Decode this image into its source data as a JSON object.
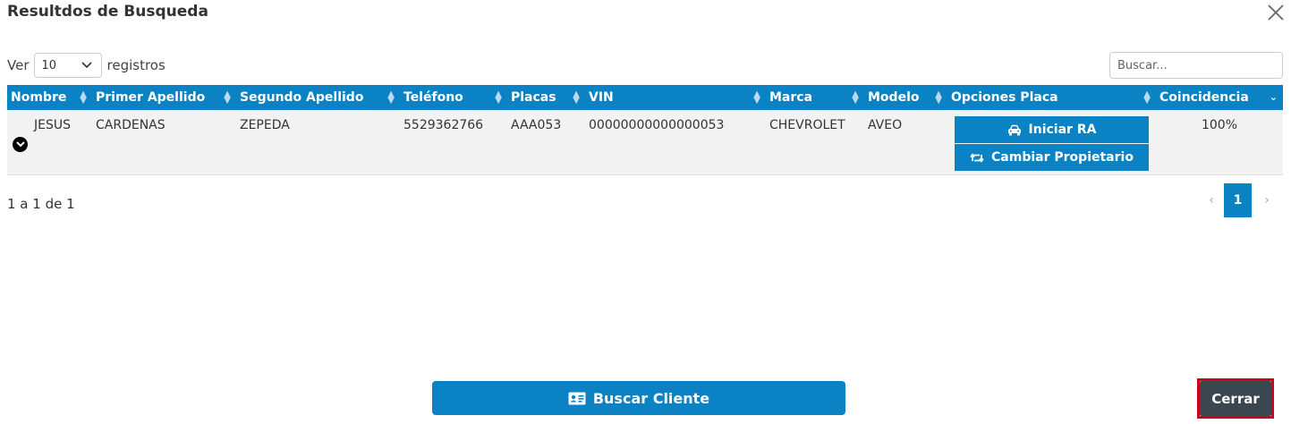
{
  "modal": {
    "title": "Resultdos de Busqueda"
  },
  "length_menu": {
    "prefix": "Ver",
    "value": "10",
    "suffix": "registros"
  },
  "search": {
    "placeholder": "Buscar..."
  },
  "table": {
    "columns": [
      "Nombre",
      "Primer Apellido",
      "Segundo Apellido",
      "Teléfono",
      "Placas",
      "VIN",
      "Marca",
      "Modelo",
      "Opciones Placa",
      "Coincidencia"
    ],
    "rows": [
      {
        "nombre": "JESUS",
        "primer_apellido": "CARDENAS",
        "segundo_apellido": "ZEPEDA",
        "telefono": "5529362766",
        "placas": "AAA053",
        "vin": "00000000000000053",
        "marca": "CHEVROLET",
        "modelo": "AVEO",
        "opciones": {
          "iniciar_label": "Iniciar RA",
          "cambiar_label": "Cambiar Propietario"
        },
        "coincidencia": "100%"
      }
    ]
  },
  "info": "1 a 1 de 1",
  "pagination": {
    "prev": "‹",
    "current": "1",
    "next": "›"
  },
  "footer": {
    "buscar_label": "Buscar Cliente",
    "cerrar_label": "Cerrar"
  },
  "colors": {
    "accent": "#0a82c4",
    "close_button": "#3a4750",
    "highlight_border": "#d0021b"
  }
}
